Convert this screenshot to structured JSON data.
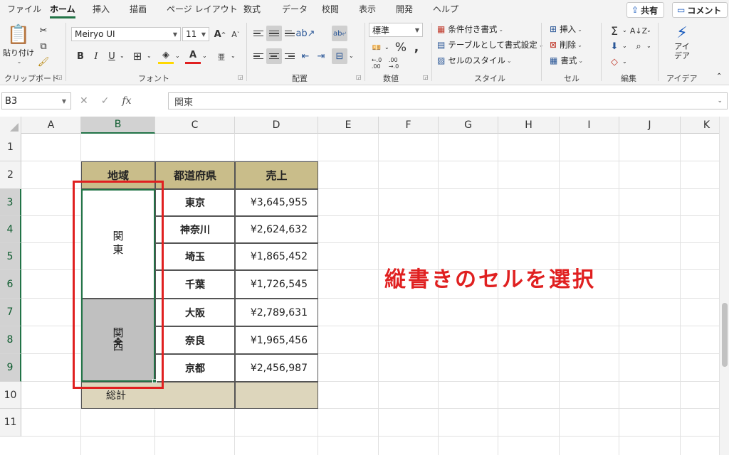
{
  "tabs": [
    "ファイル",
    "ホーム",
    "挿入",
    "描画",
    "ページ レイアウト",
    "数式",
    "データ",
    "校閲",
    "表示",
    "開発",
    "ヘルプ"
  ],
  "active_tab": "ホーム",
  "share_label": "共有",
  "comment_label": "コメント",
  "ribbon": {
    "clipboard": {
      "label": "クリップボード",
      "paste": "貼り付け"
    },
    "font": {
      "label": "フォント",
      "font_name": "Meiryo UI",
      "font_size": "11",
      "bold": "B",
      "italic": "I",
      "underline": "U",
      "grow": "A^",
      "shrink": "Aˇ",
      "phonetic": "亜"
    },
    "alignment": {
      "label": "配置"
    },
    "number": {
      "label": "数値",
      "format": "標準",
      "percent": "%",
      "comma": ","
    },
    "styles": {
      "label": "スタイル",
      "conditional": "条件付き書式",
      "table": "テーブルとして書式設定",
      "cell_styles": "セルのスタイル"
    },
    "cells": {
      "label": "セル",
      "insert": "挿入",
      "delete": "削除",
      "format": "書式"
    },
    "editing": {
      "label": "編集",
      "sum": "Σ"
    },
    "ideas": {
      "label": "アイデア",
      "button": "アイ\nデア",
      "line1": "アイ",
      "line2": "デア"
    }
  },
  "formula_bar": {
    "name_box": "B3",
    "fx": "fx",
    "content": "関東"
  },
  "columns": [
    "A",
    "B",
    "C",
    "D",
    "E",
    "F",
    "G",
    "H",
    "I",
    "J",
    "K"
  ],
  "selected_column": "B",
  "rows": [
    "1",
    "2",
    "3",
    "4",
    "5",
    "6",
    "7",
    "8",
    "9",
    "10",
    "11"
  ],
  "selected_rows": [
    "3",
    "4",
    "5",
    "6",
    "7",
    "8",
    "9"
  ],
  "table": {
    "headers": [
      "地域",
      "都道府県",
      "売上"
    ],
    "regions": [
      {
        "name": "関東",
        "rows": 4
      },
      {
        "name": "関西",
        "rows": 3
      }
    ],
    "prefectures": [
      "東京",
      "神奈川",
      "埼玉",
      "千葉",
      "大阪",
      "奈良",
      "京都"
    ],
    "sales": [
      "¥3,645,955",
      "¥2,624,632",
      "¥1,865,452",
      "¥1,726,545",
      "¥2,789,631",
      "¥1,965,456",
      "¥2,456,987"
    ],
    "total_label": "総計",
    "total_value": ""
  },
  "annotation": "縦書きのセルを選択",
  "colors": {
    "accent": "#217346",
    "header_fill": "#c9bd8a",
    "total_fill": "#ddd6bc",
    "annotation": "#e02020",
    "selection": "#c0c0c0"
  }
}
